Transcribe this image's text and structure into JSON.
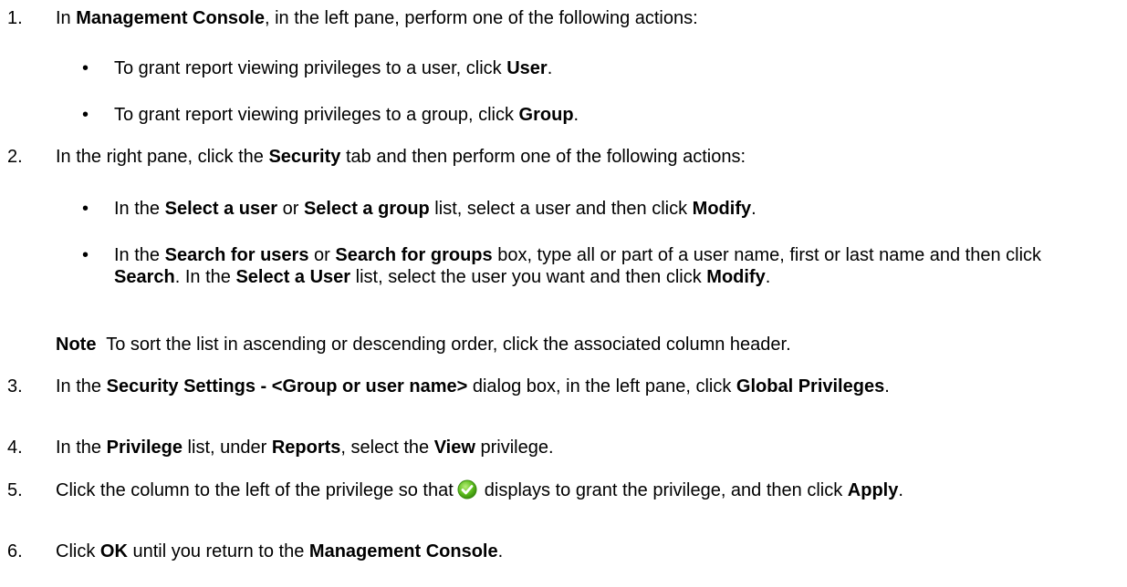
{
  "steps": [
    {
      "num": "1.",
      "parts": [
        {
          "t": "In ",
          "b": false
        },
        {
          "t": "Management Console",
          "b": true
        },
        {
          "t": ", in the left pane, perform one of the following actions:",
          "b": false
        }
      ],
      "bullets": [
        [
          {
            "t": "To grant report viewing privileges to a user, click ",
            "b": false
          },
          {
            "t": "User",
            "b": true
          },
          {
            "t": ".",
            "b": false
          }
        ],
        [
          {
            "t": "To grant report viewing privileges to a group, click ",
            "b": false
          },
          {
            "t": "Group",
            "b": true
          },
          {
            "t": ".",
            "b": false
          }
        ]
      ]
    },
    {
      "num": "2.",
      "parts": [
        {
          "t": "In the right pane, click the ",
          "b": false
        },
        {
          "t": "Security",
          "b": true
        },
        {
          "t": " tab and then perform one of the following actions:",
          "b": false
        }
      ],
      "bullets": [
        [
          {
            "t": "In the ",
            "b": false
          },
          {
            "t": "Select a user",
            "b": true
          },
          {
            "t": " or ",
            "b": false
          },
          {
            "t": "Select a group",
            "b": true
          },
          {
            "t": " list, select a user and then click ",
            "b": false
          },
          {
            "t": "Modify",
            "b": true
          },
          {
            "t": ".",
            "b": false
          }
        ],
        [
          {
            "t": "In the ",
            "b": false
          },
          {
            "t": "Search for users",
            "b": true
          },
          {
            "t": " or ",
            "b": false
          },
          {
            "t": "Search for groups",
            "b": true
          },
          {
            "t": " box, type all or part of a user name, first or last name and then click ",
            "b": false
          },
          {
            "t": "Search",
            "b": true
          },
          {
            "t": ". In the ",
            "b": false
          },
          {
            "t": "Select a User",
            "b": true
          },
          {
            "t": " list, select the user you want and then click ",
            "b": false
          },
          {
            "t": "Modify",
            "b": true
          },
          {
            "t": ".",
            "b": false
          }
        ]
      ],
      "note": [
        {
          "t": "Note",
          "b": true
        },
        {
          "t": "  To sort the list in ascending or descending order, click the associated column header.",
          "b": false
        }
      ]
    },
    {
      "num": "3.",
      "parts": [
        {
          "t": "In the ",
          "b": false
        },
        {
          "t": "Security Settings - <Group or user name>",
          "b": true
        },
        {
          "t": " dialog box, in the left pane, click ",
          "b": false
        },
        {
          "t": "Global Privileges",
          "b": true
        },
        {
          "t": ".",
          "b": false
        }
      ]
    },
    {
      "num": "4.",
      "parts": [
        {
          "t": "In the ",
          "b": false
        },
        {
          "t": "Privilege",
          "b": true
        },
        {
          "t": " list, under ",
          "b": false
        },
        {
          "t": "Reports",
          "b": true
        },
        {
          "t": ", select the ",
          "b": false
        },
        {
          "t": "View",
          "b": true
        },
        {
          "t": " privilege.",
          "b": false
        }
      ]
    },
    {
      "num": "5.",
      "parts_before_icon": [
        {
          "t": "Click the column to the left of the privilege so that",
          "b": false
        }
      ],
      "icon": "green-checkmark-icon",
      "parts": [
        {
          "t": "displays to grant the privilege, and then click ",
          "b": false
        },
        {
          "t": "Apply",
          "b": true
        },
        {
          "t": ".",
          "b": false
        }
      ]
    },
    {
      "num": "6.",
      "parts": [
        {
          "t": "Click ",
          "b": false
        },
        {
          "t": "OK",
          "b": true
        },
        {
          "t": " until you return to the ",
          "b": false
        },
        {
          "t": "Management Console",
          "b": true
        },
        {
          "t": ".",
          "b": false
        }
      ]
    }
  ]
}
